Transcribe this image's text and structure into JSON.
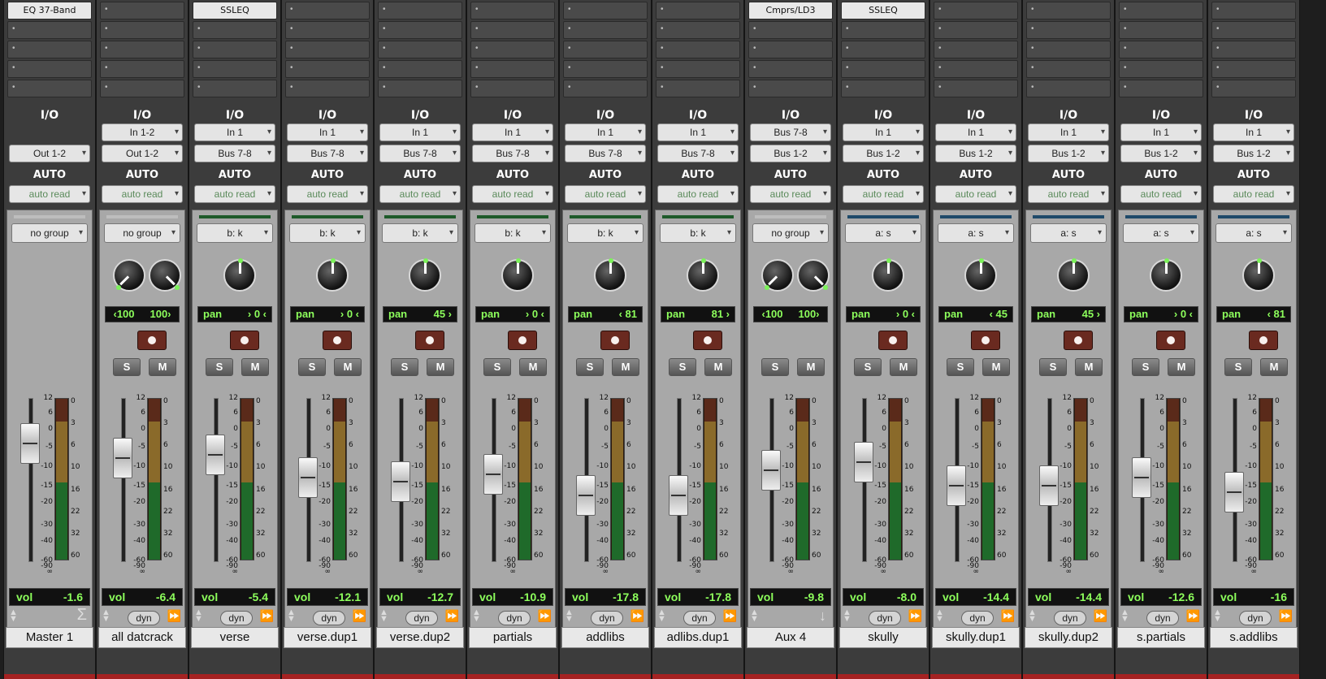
{
  "strips": [
    {
      "name": "Master 1",
      "insert": "EQ 37-Band",
      "in": "",
      "out": "Out 1-2",
      "auto": "auto read",
      "group": "no group",
      "group_color": "#bdbdbd",
      "knobs": 1,
      "pan_label": "",
      "pan_value": "",
      "pan_l": "",
      "pan_r": "",
      "vol": "-1.6",
      "fader": -4,
      "has_rec": false,
      "has_sm": false,
      "footer": "sigma"
    },
    {
      "name": "all datcrack",
      "insert": "",
      "in": "In 1-2",
      "out": "Out 1-2",
      "auto": "auto read",
      "group": "no group",
      "group_color": "#bdbdbd",
      "knobs": 2,
      "pan_label": "",
      "pan_value": "",
      "pan_l": "‹100",
      "pan_r": "100›",
      "vol": "-6.4",
      "fader": -8,
      "has_rec": true,
      "has_sm": true,
      "footer": "dyn"
    },
    {
      "name": "verse",
      "insert": "SSLEQ",
      "in": "In 1",
      "out": "Bus 7-8",
      "auto": "auto read",
      "group": "b: k",
      "group_color": "#1e5a2a",
      "knobs": 1,
      "pan_label": "pan",
      "pan_value": "› 0 ‹",
      "pan_l": "",
      "pan_r": "",
      "vol": "-5.4",
      "fader": -7,
      "has_rec": true,
      "has_sm": true,
      "footer": "dyn"
    },
    {
      "name": "verse.dup1",
      "insert": "",
      "in": "In 1",
      "out": "Bus 7-8",
      "auto": "auto read",
      "group": "b: k",
      "group_color": "#1e5a2a",
      "knobs": 1,
      "pan_label": "pan",
      "pan_value": "› 0 ‹",
      "pan_l": "",
      "pan_r": "",
      "vol": "-12.1",
      "fader": -13,
      "has_rec": true,
      "has_sm": true,
      "footer": "dyn"
    },
    {
      "name": "verse.dup2",
      "insert": "",
      "in": "In 1",
      "out": "Bus 7-8",
      "auto": "auto read",
      "group": "b: k",
      "group_color": "#1e5a2a",
      "knobs": 1,
      "pan_label": "pan",
      "pan_value": "45 ›",
      "pan_l": "",
      "pan_r": "",
      "vol": "-12.7",
      "fader": -14,
      "has_rec": true,
      "has_sm": true,
      "footer": "dyn"
    },
    {
      "name": "partials",
      "insert": "",
      "in": "In 1",
      "out": "Bus 7-8",
      "auto": "auto read",
      "group": "b: k",
      "group_color": "#1e5a2a",
      "knobs": 1,
      "pan_label": "pan",
      "pan_value": "› 0 ‹",
      "pan_l": "",
      "pan_r": "",
      "vol": "-10.9",
      "fader": -12,
      "has_rec": true,
      "has_sm": true,
      "footer": "dyn"
    },
    {
      "name": "addlibs",
      "insert": "",
      "in": "In 1",
      "out": "Bus 7-8",
      "auto": "auto read",
      "group": "b: k",
      "group_color": "#1e5a2a",
      "knobs": 1,
      "pan_label": "pan",
      "pan_value": "‹ 81",
      "pan_l": "",
      "pan_r": "",
      "vol": "-17.8",
      "fader": -18,
      "has_rec": true,
      "has_sm": true,
      "footer": "dyn"
    },
    {
      "name": "adlibs.dup1",
      "insert": "",
      "in": "In 1",
      "out": "Bus 7-8",
      "auto": "auto read",
      "group": "b: k",
      "group_color": "#1e5a2a",
      "knobs": 1,
      "pan_label": "pan",
      "pan_value": "81 ›",
      "pan_l": "",
      "pan_r": "",
      "vol": "-17.8",
      "fader": -18,
      "has_rec": true,
      "has_sm": true,
      "footer": "dyn"
    },
    {
      "name": "Aux 4",
      "insert": "Cmprs/LD3",
      "in": "Bus 7-8",
      "out": "Bus 1-2",
      "auto": "auto read",
      "group": "no group",
      "group_color": "#bdbdbd",
      "knobs": 2,
      "pan_label": "",
      "pan_value": "",
      "pan_l": "‹100",
      "pan_r": "100›",
      "vol": "-9.8",
      "fader": -11,
      "has_rec": false,
      "has_sm": true,
      "footer": "down"
    },
    {
      "name": "skully",
      "insert": "SSLEQ",
      "in": "In 1",
      "out": "Bus 1-2",
      "auto": "auto read",
      "group": "a: s",
      "group_color": "#1f4a6a",
      "knobs": 1,
      "pan_label": "pan",
      "pan_value": "› 0 ‹",
      "pan_l": "",
      "pan_r": "",
      "vol": "-8.0",
      "fader": -9,
      "has_rec": true,
      "has_sm": true,
      "footer": "dyn"
    },
    {
      "name": "skully.dup1",
      "insert": "",
      "in": "In 1",
      "out": "Bus 1-2",
      "auto": "auto read",
      "group": "a: s",
      "group_color": "#1f4a6a",
      "knobs": 1,
      "pan_label": "pan",
      "pan_value": "‹ 45",
      "pan_l": "",
      "pan_r": "",
      "vol": "-14.4",
      "fader": -15,
      "has_rec": true,
      "has_sm": true,
      "footer": "dyn"
    },
    {
      "name": "skully.dup2",
      "insert": "",
      "in": "In 1",
      "out": "Bus 1-2",
      "auto": "auto read",
      "group": "a: s",
      "group_color": "#1f4a6a",
      "knobs": 1,
      "pan_label": "pan",
      "pan_value": "45 ›",
      "pan_l": "",
      "pan_r": "",
      "vol": "-14.4",
      "fader": -15,
      "has_rec": true,
      "has_sm": true,
      "footer": "dyn"
    },
    {
      "name": "s.partials",
      "insert": "",
      "in": "In 1",
      "out": "Bus 1-2",
      "auto": "auto read",
      "group": "a: s",
      "group_color": "#1f4a6a",
      "knobs": 1,
      "pan_label": "pan",
      "pan_value": "› 0 ‹",
      "pan_l": "",
      "pan_r": "",
      "vol": "-12.6",
      "fader": -13,
      "has_rec": true,
      "has_sm": true,
      "footer": "dyn"
    },
    {
      "name": "s.addlibs",
      "insert": "",
      "in": "In 1",
      "out": "Bus 1-2",
      "auto": "auto read",
      "group": "a: s",
      "group_color": "#1f4a6a",
      "knobs": 1,
      "pan_label": "pan",
      "pan_value": "‹ 81",
      "pan_l": "",
      "pan_r": "",
      "vol": "-16",
      "fader": -17,
      "has_rec": true,
      "has_sm": true,
      "footer": "dyn"
    }
  ],
  "labels": {
    "io": "I/O",
    "auto": "AUTO",
    "vol": "vol",
    "dyn": "dyn",
    "solo": "S",
    "mute": "M"
  },
  "scale_marks": [
    "12",
    "6",
    "0",
    "-5",
    "-10",
    "-15",
    "-20",
    "-30",
    "-40",
    "-60",
    "-90",
    "∞"
  ],
  "meter_marks": [
    "0",
    "3",
    "6",
    "10",
    "16",
    "22",
    "32",
    "60"
  ]
}
